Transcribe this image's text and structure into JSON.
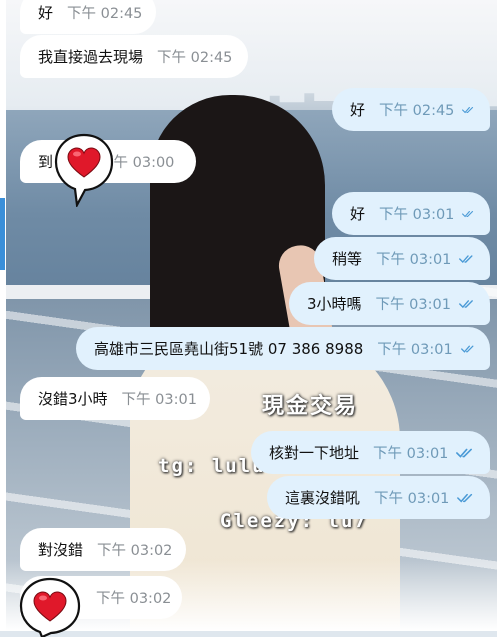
{
  "watermarks": {
    "line_1": "現金交易",
    "line_2": "tg: lulu",
    "line_3": "Gleezy: lu7"
  },
  "messages": [
    {
      "dir": "in",
      "text": "好",
      "time": "下午 02:45"
    },
    {
      "dir": "in",
      "text": "我直接過去現場",
      "time": "下午 02:45"
    },
    {
      "dir": "out",
      "text": "好",
      "time": "下午 02:45",
      "status": "read"
    },
    {
      "dir": "in",
      "text": "到",
      "time": "下午 03:00"
    },
    {
      "dir": "out",
      "text": "好",
      "time": "下午 03:01",
      "status": "read"
    },
    {
      "dir": "out",
      "text": "稍等",
      "time": "下午 03:01",
      "status": "read"
    },
    {
      "dir": "out",
      "text": "3小時嗎",
      "time": "下午 03:01",
      "status": "read"
    },
    {
      "dir": "out",
      "text": "高雄市三民區堯山街51號 07 386 8988",
      "time": "下午 03:01",
      "status": "read"
    },
    {
      "dir": "in",
      "text": "沒錯3小時",
      "time": "下午 03:01"
    },
    {
      "dir": "out",
      "text": "核對一下地址",
      "time": "下午 03:01",
      "status": "read"
    },
    {
      "dir": "out",
      "text": "這裏沒錯吼",
      "time": "下午 03:01",
      "status": "read"
    },
    {
      "dir": "in",
      "text": "對沒錯",
      "time": "下午 03:02"
    },
    {
      "dir": "in",
      "text": "",
      "time": "下午 03:02"
    }
  ],
  "colors": {
    "incoming": "#ffffff",
    "outgoing": "#e1f1fd",
    "check": "#4a9ad6",
    "heart": "#e0182a"
  },
  "icons": {
    "read_status": "double-check-icon",
    "sticker": "heart-speech-bubble-icon"
  }
}
